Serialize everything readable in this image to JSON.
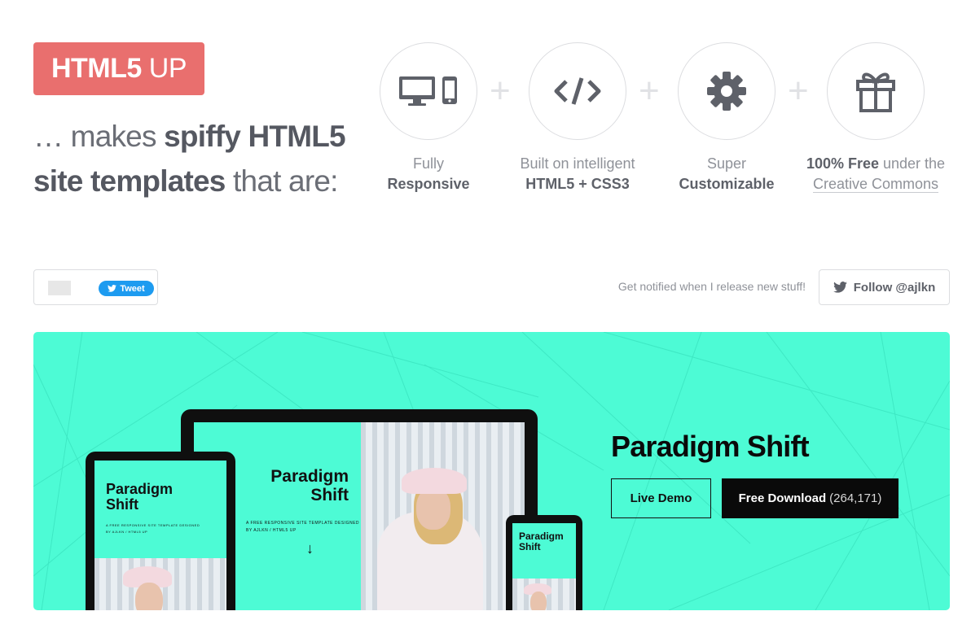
{
  "logo": {
    "bold": "HTML5",
    "light": "UP"
  },
  "tagline": {
    "part1": "… makes ",
    "bold1": "spiffy HTML5 site templates",
    "part2": " that are:"
  },
  "features": [
    {
      "icon": "devices-icon",
      "line1": "Fully",
      "line2": "Responsive"
    },
    {
      "icon": "code-icon",
      "line1": "Built on intelligent",
      "line2": "HTML5 + CSS3"
    },
    {
      "icon": "gear-icon",
      "line1": "Super",
      "line2": "Customizable"
    },
    {
      "icon": "gift-icon",
      "bold": "100% Free",
      "rest": " under the",
      "line2": "Creative Commons"
    }
  ],
  "plus_sign": "+",
  "social": {
    "tweet_label": "Tweet",
    "notify_text": "Get notified when I release new stuff!",
    "follow_label": "Follow @ajlkn"
  },
  "template": {
    "name": "Paradigm Shift",
    "live_demo_label": "Live Demo",
    "download_label": "Free Download",
    "download_count": "(264,171)",
    "mockup_title_line1": "Paradigm",
    "mockup_title_line2": "Shift",
    "mockup_subtitle": "A FREE RESPONSIVE SITE TEMPLATE DESIGNED",
    "mockup_credit": "BY AJLKN / HTML5 UP",
    "mockup_arrow": "↓",
    "accent_color": "#4dfbd5"
  },
  "colors": {
    "logo_bg": "#e96f6e",
    "twitter_blue": "#1d9bf0"
  }
}
